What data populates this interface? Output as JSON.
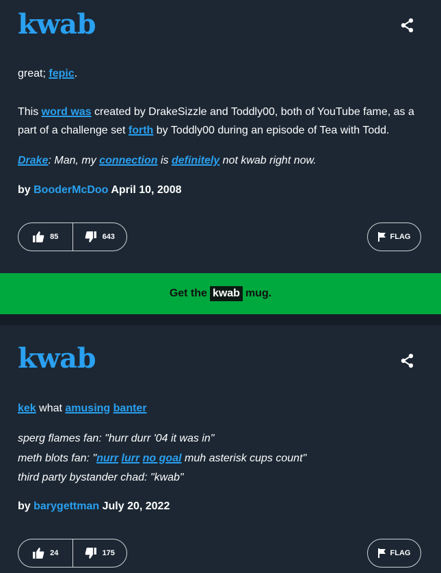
{
  "entries": [
    {
      "word": "kwab",
      "meaning": {
        "t1": "great; ",
        "l1": "fepic",
        "t2": "."
      },
      "desc": {
        "t1": "This ",
        "l1": "word was",
        "t2": " created by DrakeSizzle and Toddly00, both of YouTube fame, as a part of a challenge set ",
        "l2": "forth",
        "t3": " by Toddly00 during an episode of Tea with Todd."
      },
      "example": {
        "l1": "Drake",
        "t1": ": Man, my ",
        "l2": "connection",
        "t2": " is ",
        "l3": "definitely",
        "t3": " not kwab right now."
      },
      "by_label": "by",
      "author": "BooderMcDoo",
      "date": "April 10, 2008",
      "upvotes": "85",
      "downvotes": "643",
      "flag_label": "FLAG"
    },
    {
      "word": "kwab",
      "meaning": {
        "l1": "kek",
        "t1": " what ",
        "l2": "amusing",
        "t2": " ",
        "l3": "banter"
      },
      "example_lines": {
        "line1": "sperg flames fan: \"hurr durr '04 it was in\"",
        "line2_t1": "meth blots fan: \"",
        "line2_l1": "nurr",
        "line2_t2": " ",
        "line2_l2": "lurr",
        "line2_t3": " ",
        "line2_l3": "no goal",
        "line2_t4": " muh asterisk cups count\"",
        "line3": "third party bystander chad: \"kwab\""
      },
      "by_label": "by",
      "author": "barygettman",
      "date": "July 20, 2022",
      "upvotes": "24",
      "downvotes": "175",
      "flag_label": "FLAG"
    }
  ],
  "mug": {
    "prefix": "Get the",
    "word": "kwab",
    "suffix": "mug."
  },
  "icons": [
    "share-icon",
    "thumbs-up-icon",
    "thumbs-down-icon",
    "flag-icon"
  ],
  "colors": {
    "background": "#1c2733",
    "accent": "#2aa0f0",
    "mug_banner": "#00a93e"
  }
}
